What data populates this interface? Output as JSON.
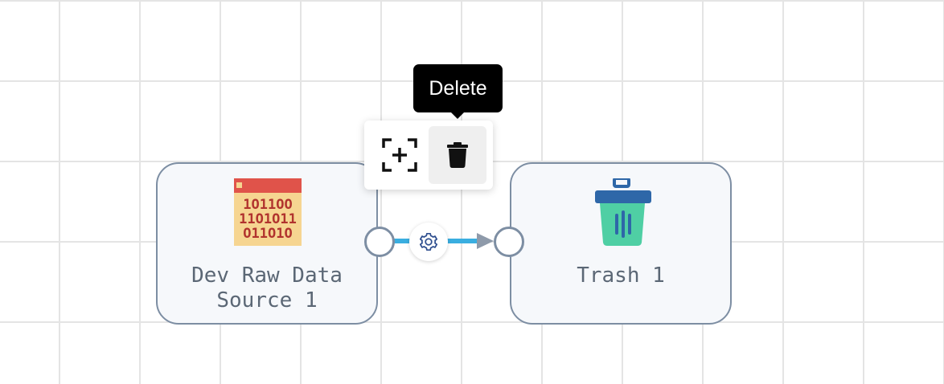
{
  "nodes": {
    "source": {
      "label": "Dev Raw Data\nSource 1",
      "icon": "binary-data-calendar-icon"
    },
    "trash": {
      "label": "Trash 1",
      "icon": "trash-bin-icon"
    }
  },
  "edge": {
    "settings_icon": "gear-icon",
    "color": "#3aaee0",
    "arrow_color": "#8e9aaa"
  },
  "toolbar": {
    "fit_icon": "fit-to-screen-icon",
    "delete_icon": "trash-can-icon",
    "tooltip": "Delete"
  },
  "colors": {
    "node_border": "#7d8ea3",
    "node_background": "#f6f8fb",
    "grid": "#e4e4e4"
  }
}
